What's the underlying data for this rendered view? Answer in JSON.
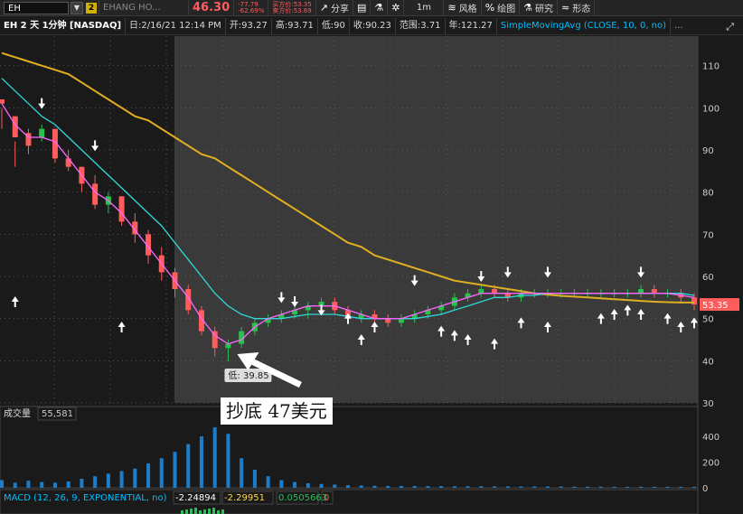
{
  "toolbar": {
    "symbol": "EH",
    "link_badge": "2",
    "company_name": "EHANG HO...",
    "last_price": "46.30",
    "net_change": "-77.79",
    "pct_change": "-62.69%",
    "bid_label": "买方价:53.35",
    "ask_label": "卖方价:53.69",
    "buttons": [
      {
        "icon": "share-icon",
        "glyph": "↗",
        "label": "分享"
      },
      {
        "icon": "notebook-icon",
        "glyph": "▤",
        "label": ""
      },
      {
        "icon": "flask-icon",
        "glyph": "⚗",
        "label": ""
      },
      {
        "icon": "gear-icon",
        "glyph": "✲",
        "label": ""
      },
      {
        "icon": "timeframe-icon",
        "glyph": "",
        "label": "1m"
      },
      {
        "icon": "style-icon",
        "glyph": "≋",
        "label": "风格"
      },
      {
        "icon": "draw-icon",
        "glyph": "%",
        "label": "绘图"
      },
      {
        "icon": "study-icon",
        "glyph": "⚗",
        "label": "研究"
      },
      {
        "icon": "pattern-icon",
        "glyph": "≈",
        "label": "形态"
      }
    ]
  },
  "info": {
    "title": "EH 2 天 1分钟 [NASDAQ]",
    "date": "日:2/16/21 12:14 PM",
    "open": "开:93.27",
    "high": "高:93.71",
    "low": "低:90",
    "close": "收:90.23",
    "range": "范围:3.71",
    "year": "年:121.27",
    "study": "SimpleMovingAvg (CLOSE, 10, 0, no)",
    "more": "..."
  },
  "colors": {
    "background": "#1a1a1a",
    "session_bg": "#3a3a3a",
    "up": "#27c24c",
    "down": "#ff5c5c",
    "sma_fast": "#ff66ff",
    "sma_mid": "#30d8d8",
    "sma_slow": "#e0b020",
    "macd_bar": "#2bbd5a",
    "volume_bar": "#1e7dc8",
    "price_tag": "#ff5c5c"
  },
  "caption": "抄底  47美元",
  "chart_data": [
    {
      "type": "candlestick",
      "title": "EH 2 天 1分钟 [NASDAQ]",
      "y_ticks": [
        110,
        100,
        90,
        80,
        70,
        60,
        50,
        40,
        30
      ],
      "ylim": [
        30,
        117
      ],
      "last_price_tag": "53.35",
      "low_label": "低: 39.85",
      "ohlc_every_10_bars": [
        [
          102,
          100,
          95,
          101
        ],
        [
          98,
          92,
          86,
          93
        ],
        [
          94,
          95,
          89,
          91
        ],
        [
          93,
          96,
          92,
          95
        ],
        [
          95,
          95,
          87,
          88
        ],
        [
          88,
          90,
          85,
          86
        ],
        [
          86,
          86,
          80,
          82
        ],
        [
          82,
          84,
          76,
          77
        ],
        [
          77,
          80,
          75,
          79
        ],
        [
          79,
          79,
          72,
          73
        ],
        [
          73,
          75,
          68,
          70
        ],
        [
          70,
          71,
          63,
          65
        ],
        [
          65,
          67,
          59,
          61
        ],
        [
          61,
          62,
          55,
          57
        ],
        [
          57,
          58,
          51,
          52
        ],
        [
          52,
          53,
          46,
          47
        ],
        [
          47,
          48,
          41,
          43
        ],
        [
          43,
          45,
          39.85,
          44
        ],
        [
          44,
          48,
          43,
          47
        ],
        [
          47,
          50,
          46,
          49
        ],
        [
          49,
          51,
          48,
          50
        ],
        [
          50,
          52,
          49,
          51
        ],
        [
          51,
          53,
          50,
          52
        ],
        [
          52,
          54,
          50,
          53
        ],
        [
          53,
          55,
          52,
          54
        ],
        [
          54,
          55,
          51,
          52
        ],
        [
          52,
          53,
          49,
          50
        ],
        [
          50,
          52,
          49,
          51
        ],
        [
          51,
          52,
          49,
          50
        ],
        [
          50,
          51,
          48,
          49
        ],
        [
          49,
          51,
          48,
          50
        ],
        [
          50,
          52,
          49,
          51
        ],
        [
          51,
          53,
          50,
          52
        ],
        [
          52,
          54,
          51,
          53
        ],
        [
          53,
          56,
          52,
          55
        ],
        [
          55,
          57,
          54,
          56
        ],
        [
          56,
          58,
          55,
          57
        ],
        [
          57,
          58,
          55,
          56
        ],
        [
          56,
          57,
          54,
          55
        ],
        [
          55,
          57,
          54,
          56
        ],
        [
          56,
          57,
          55,
          56
        ],
        [
          56,
          57,
          55,
          56
        ],
        [
          56,
          57,
          55,
          56
        ],
        [
          56,
          57,
          55,
          56
        ],
        [
          56,
          57,
          55,
          56
        ],
        [
          56,
          57,
          55,
          56
        ],
        [
          56,
          57,
          55,
          56
        ],
        [
          56,
          57,
          55,
          56
        ],
        [
          56,
          58,
          55,
          57
        ],
        [
          57,
          58,
          55,
          56
        ],
        [
          56,
          57,
          55,
          56
        ],
        [
          56,
          57,
          54,
          55
        ],
        [
          55,
          56,
          52,
          53.35
        ]
      ],
      "sma_fast": [
        101,
        96,
        93,
        93,
        92,
        88,
        84,
        80,
        78,
        75,
        71,
        67,
        63,
        59,
        55,
        50,
        46,
        44,
        45,
        48,
        50,
        51,
        52,
        53,
        53,
        53,
        52,
        51,
        50,
        50,
        50,
        51,
        52,
        53,
        54,
        55,
        56,
        56,
        56,
        56,
        56,
        56,
        56,
        56,
        56,
        56,
        56,
        56,
        56,
        56,
        56,
        55.5,
        55
      ],
      "sma_mid": [
        107,
        104,
        101,
        98,
        96,
        93,
        90,
        87,
        84,
        81,
        78,
        75,
        72,
        68,
        64,
        60,
        56,
        53,
        51,
        50,
        50,
        50,
        50.5,
        51,
        51,
        51,
        50.5,
        50,
        50,
        50,
        50,
        50,
        50.5,
        51,
        52,
        53,
        54,
        55,
        55,
        55.5,
        55.5,
        56,
        56,
        56,
        56,
        56,
        56,
        56,
        56,
        56,
        56,
        56,
        55.5
      ],
      "sma_slow": [
        113,
        112,
        111,
        110,
        109,
        108,
        106,
        104,
        102,
        100,
        98,
        97,
        95,
        93,
        91,
        89,
        88,
        86,
        84,
        82,
        80,
        78,
        76,
        74,
        72,
        70,
        68,
        67,
        65,
        64,
        63,
        62,
        61,
        60,
        59,
        58.5,
        58,
        57.5,
        57,
        56.5,
        56,
        55.7,
        55.4,
        55.2,
        55,
        54.8,
        54.6,
        54.4,
        54.2,
        54,
        53.9,
        53.8,
        53.8
      ],
      "arrows_up_near_price": [
        57,
        51,
        53,
        48,
        51,
        50,
        49,
        48,
        47,
        52,
        51,
        53,
        54,
        55,
        54,
        53,
        51,
        52
      ],
      "arrows_down_near_price": [
        98,
        88,
        52,
        51,
        49,
        56,
        57,
        58,
        58,
        58
      ]
    },
    {
      "type": "bar",
      "title": "成交量",
      "label": "55,581",
      "y_ticks": [
        400,
        200,
        0
      ],
      "ylim": [
        0,
        520
      ],
      "values_every_10_bars": [
        60,
        40,
        55,
        45,
        40,
        50,
        70,
        90,
        110,
        130,
        150,
        190,
        230,
        280,
        340,
        400,
        470,
        420,
        230,
        140,
        90,
        60,
        45,
        35,
        30,
        25,
        20,
        18,
        16,
        15,
        14,
        14,
        13,
        13,
        12,
        12,
        12,
        11,
        11,
        10,
        10,
        10,
        10,
        9,
        9,
        9,
        8,
        8,
        8,
        8,
        8,
        8,
        8
      ]
    },
    {
      "type": "bar",
      "title": "MACD (12, 26, 9, EXPONENTIAL, no)",
      "values": [
        "-2.24894",
        "-2.29951",
        "0.0505663",
        "0"
      ]
    }
  ]
}
